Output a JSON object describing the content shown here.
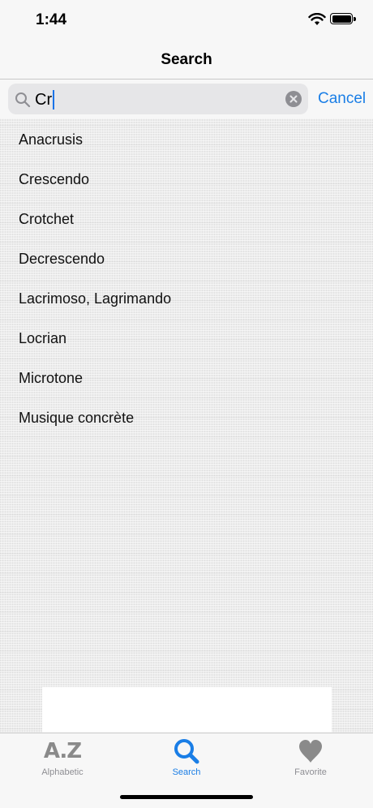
{
  "status": {
    "time": "1:44"
  },
  "nav": {
    "title": "Search"
  },
  "search": {
    "query": "Cr",
    "cancel_label": "Cancel"
  },
  "results": [
    "Anacrusis",
    "Crescendo",
    "Crotchet",
    "Decrescendo",
    "Lacrimoso, Lagrimando",
    "Locrian",
    "Microtone",
    "Musique concrète"
  ],
  "tabs": [
    {
      "label": "Alphabetic",
      "icon": "az-icon",
      "glyph": "A.Z",
      "active": false
    },
    {
      "label": "Search",
      "icon": "search-icon",
      "active": true
    },
    {
      "label": "Favorite",
      "icon": "heart-icon",
      "active": false
    }
  ],
  "colors": {
    "accent": "#1a7ee6",
    "inactive": "#8e8e93",
    "caret": "#1a73e8"
  }
}
